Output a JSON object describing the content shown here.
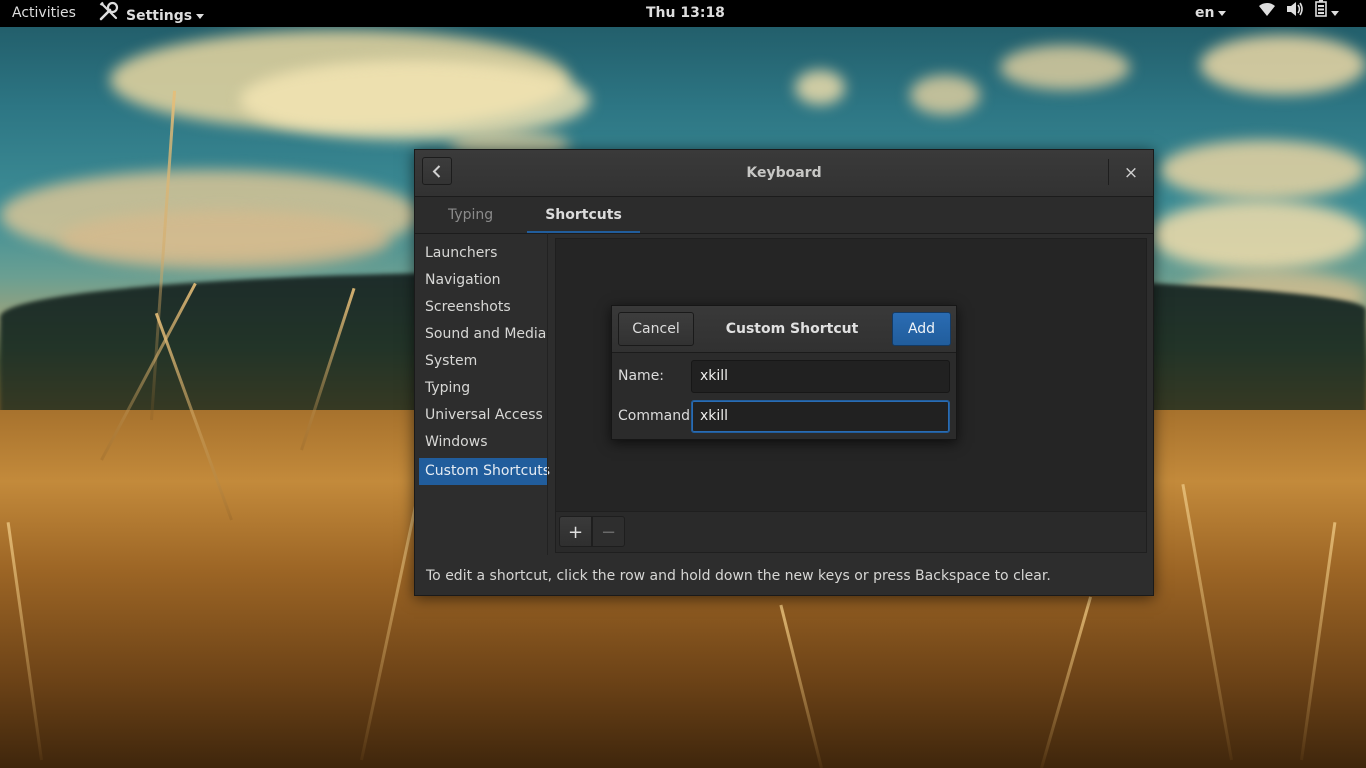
{
  "topbar": {
    "activities": "Activities",
    "app_menu": "Settings",
    "clock": "Thu 13:18",
    "language": "en"
  },
  "window": {
    "title": "Keyboard",
    "close_glyph": "×",
    "tabs": [
      {
        "label": "Typing",
        "active": false
      },
      {
        "label": "Shortcuts",
        "active": true
      }
    ],
    "sidebar": {
      "items": [
        {
          "label": "Launchers",
          "selected": false
        },
        {
          "label": "Navigation",
          "selected": false
        },
        {
          "label": "Screenshots",
          "selected": false
        },
        {
          "label": "Sound and Media",
          "selected": false
        },
        {
          "label": "System",
          "selected": false
        },
        {
          "label": "Typing",
          "selected": false
        },
        {
          "label": "Universal Access",
          "selected": false
        },
        {
          "label": "Windows",
          "selected": false
        },
        {
          "label": "Custom Shortcuts",
          "selected": true
        }
      ]
    },
    "toolbar": {
      "add_glyph": "+",
      "remove_glyph": "−"
    },
    "footer_hint": "To edit a shortcut, click the row and hold down the new keys or press Backspace to clear."
  },
  "dialog": {
    "title": "Custom Shortcut",
    "cancel_label": "Cancel",
    "add_label": "Add",
    "name_label": "Name:",
    "name_value": "xkill",
    "command_label": "Command:",
    "command_value": "xkill"
  },
  "icons": {
    "settings": "wrench-screwdriver-icon",
    "wifi": "wifi-icon",
    "volume": "volume-icon",
    "battery": "battery-icon",
    "back": "chevron-left-icon",
    "close": "close-icon"
  },
  "colors": {
    "accent": "#215d9c",
    "window_bg": "#2d2d2d",
    "topbar_bg": "#000000"
  }
}
